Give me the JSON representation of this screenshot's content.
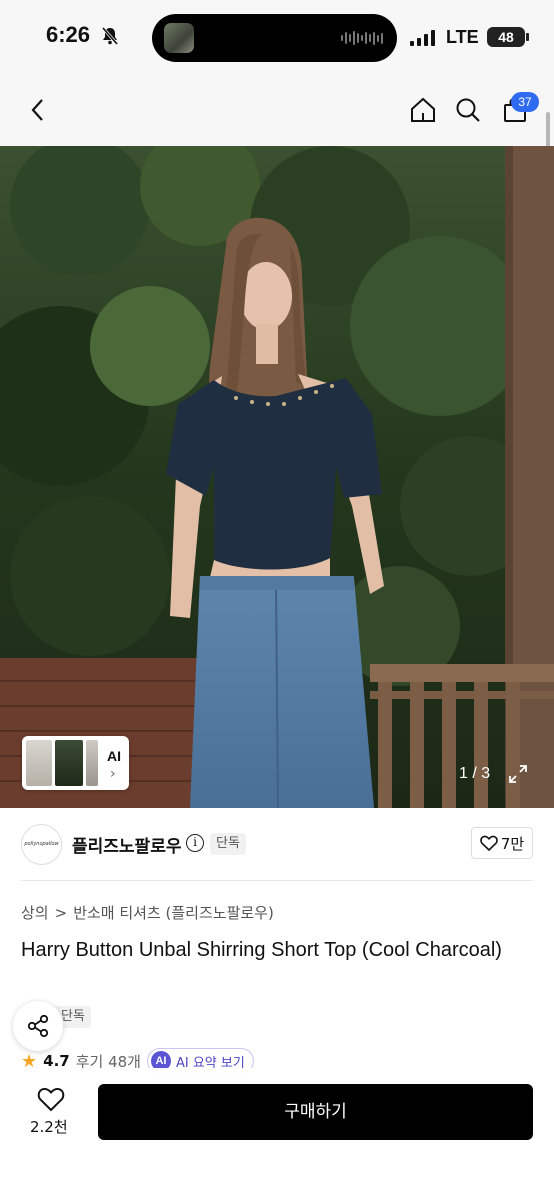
{
  "status_bar": {
    "time": "6:26",
    "network": "LTE",
    "battery": "48",
    "battery_level_percent": 48,
    "icons": [
      "bell-slash-icon",
      "signal-icon",
      "battery-icon"
    ]
  },
  "nav": {
    "icons": [
      "back-chevron-icon",
      "home-icon",
      "search-icon",
      "cart-icon"
    ],
    "cart_badge": "37"
  },
  "gallery": {
    "ai_label": "AI",
    "ai_chevron": "›",
    "page_indicator": "1 / 3",
    "expand_icon": "expand-arrows-icon"
  },
  "brand": {
    "logo_text": "pollynopallow",
    "name": "플리즈노팔로우",
    "info_icon": "i",
    "badge": "단독",
    "likes": "7만"
  },
  "breadcrumb": {
    "category": "상의",
    "separator": ">",
    "subcategory": "반소매 티셔츠 (플리즈노팔로우)"
  },
  "product": {
    "title": "Harry Button Unbal Shirring Short Top (Cool Charcoal)",
    "badge": "단독",
    "rating_star": "★",
    "rating": "4.7",
    "reviews": "후기 48개",
    "ai_badge": "AI",
    "ai_summary": "AI 요약 보기"
  },
  "bottom_bar": {
    "wishlist_count": "2.2천",
    "buy_label": "구매하기"
  },
  "colors": {
    "accent_blue": "#2f6bf0",
    "ai_purple": "#5b55d6",
    "star": "#f5a623",
    "buy_button": "#000000"
  }
}
